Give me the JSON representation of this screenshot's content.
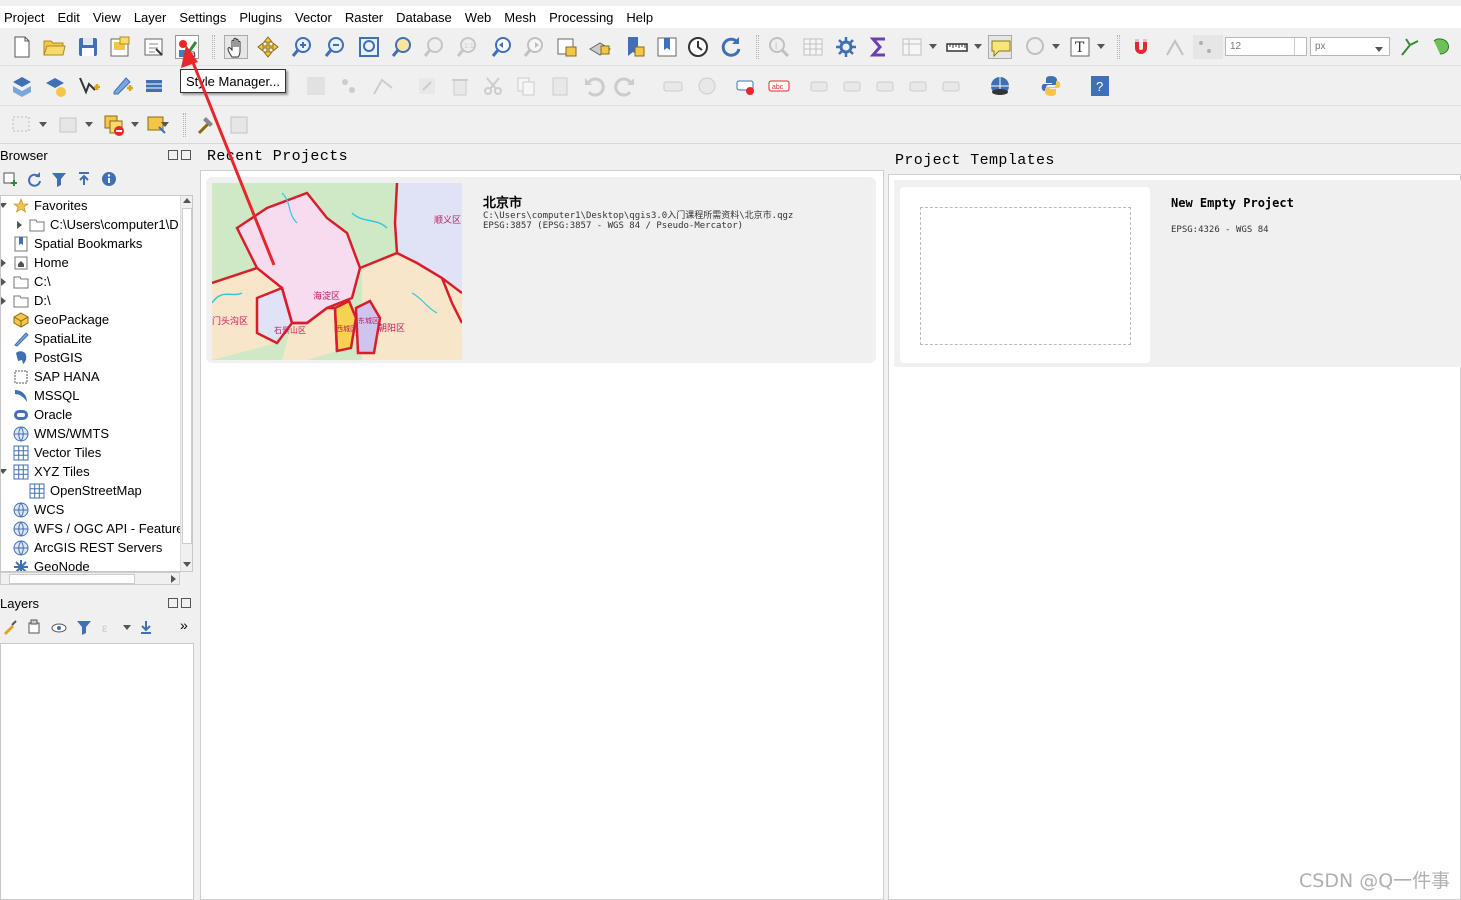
{
  "menu": [
    "Project",
    "Edit",
    "View",
    "Layer",
    "Settings",
    "Plugins",
    "Vector",
    "Raster",
    "Database",
    "Web",
    "Mesh",
    "Processing",
    "Help"
  ],
  "tooltip": "Style Manager...",
  "toolbar": {
    "font_size_value": "12",
    "unit_value": "px"
  },
  "browser": {
    "title": "Browser",
    "items": [
      {
        "label": "Favorites",
        "icon": "star-icon"
      },
      {
        "label": "C:\\Users\\computer1\\D",
        "icon": "folder-icon"
      },
      {
        "label": "Spatial Bookmarks",
        "icon": "bookmark-icon"
      },
      {
        "label": "Home",
        "icon": "home-folder-icon"
      },
      {
        "label": "C:\\",
        "icon": "folder-icon"
      },
      {
        "label": "D:\\",
        "icon": "folder-icon"
      },
      {
        "label": "GeoPackage",
        "icon": "geopackage-icon"
      },
      {
        "label": "SpatiaLite",
        "icon": "spatialite-icon"
      },
      {
        "label": "PostGIS",
        "icon": "postgis-icon"
      },
      {
        "label": "SAP HANA",
        "icon": "sap-hana-icon"
      },
      {
        "label": "MSSQL",
        "icon": "mssql-icon"
      },
      {
        "label": "Oracle",
        "icon": "oracle-icon"
      },
      {
        "label": "WMS/WMTS",
        "icon": "globe-icon"
      },
      {
        "label": "Vector Tiles",
        "icon": "grid-icon"
      },
      {
        "label": "XYZ Tiles",
        "icon": "grid-icon"
      },
      {
        "label": "OpenStreetMap",
        "icon": "grid-icon"
      },
      {
        "label": "WCS",
        "icon": "globe-icon"
      },
      {
        "label": "WFS / OGC API - Feature",
        "icon": "globe-icon"
      },
      {
        "label": "ArcGIS REST Servers",
        "icon": "globe-icon"
      },
      {
        "label": "GeoNode",
        "icon": "geonode-icon"
      }
    ]
  },
  "layers": {
    "title": "Layers"
  },
  "recent": {
    "title": "Recent Projects",
    "project": {
      "name": "北京市",
      "path": "C:\\Users\\computer1\\Desktop\\qgis3.0入门课程所需资料\\北京市.qgz",
      "crs": "EPSG:3857 (EPSG:3857 - WGS 84 / Pseudo-Mercator)",
      "map_labels": [
        "顺义区",
        "海淀区",
        "门头沟区",
        "石景山区",
        "朝阳区",
        "西城区",
        "东城区"
      ]
    }
  },
  "templates": {
    "title": "Project Templates",
    "item": {
      "name": "New Empty Project",
      "crs": "EPSG:4326 - WGS 84"
    }
  },
  "watermark": "CSDN @Q一件事",
  "colors": {
    "accent_red": "#e8262c",
    "map_boundary": "#d81e2a",
    "tooltip_bg": "#ffffff"
  }
}
